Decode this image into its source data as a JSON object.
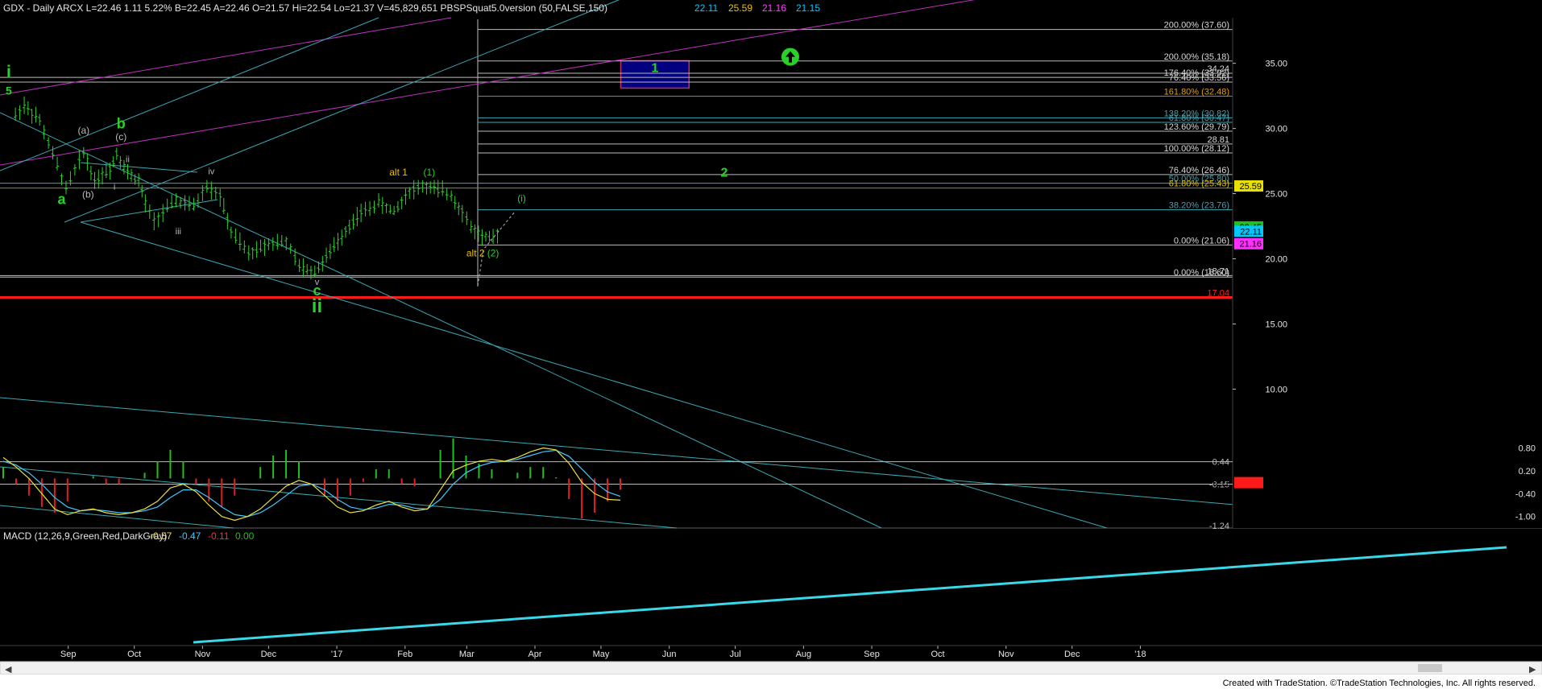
{
  "header": {
    "symbol_info": "GDX - Daily  ARCX  L=22.46  1.11  5.22%  B=22.45  A=22.46  O=21.57  Hi=22.54  Lo=21.37  V=45,829,651  PBSPSquat5.0version (50,FALSE,150)",
    "ind_values": [
      {
        "text": "22.11",
        "color": "#00c8ff"
      },
      {
        "text": "25.59",
        "color": "#e8c000"
      },
      {
        "text": "21.16",
        "color": "#ff40ff"
      },
      {
        "text": "21.15",
        "color": "#00c8ff"
      }
    ]
  },
  "macd": {
    "title": "MACD (12,26,9,Green,Red,DarkGray)",
    "values": [
      {
        "text": "-0.57",
        "color": "#e8e040"
      },
      {
        "text": "-0.47",
        "color": "#40c8ff"
      },
      {
        "text": "-0.11",
        "color": "#ff3030"
      },
      {
        "text": "0.00",
        "color": "#20c020"
      }
    ]
  },
  "colors": {
    "background": "#000000",
    "grid_lines": "#bcbcbc",
    "trend_lines": "#3aa8b4",
    "channel_magenta": "#c030c0",
    "bars": "#30d030",
    "wave_green": "#2ad02a",
    "target_box_fill": "#000080",
    "target_box_border": "#c03060",
    "support_red": "#ff1a1a",
    "macd_signal": "#40c8ff",
    "macd_line": "#e8e040"
  },
  "chart_data": [
    {
      "type": "bar",
      "title": "GDX - Daily",
      "subtitle": "ARCX",
      "series_style": "OHLC",
      "x_tick_labels": [
        "Sep",
        "Oct",
        "Nov",
        "Dec",
        "'17",
        "Feb",
        "Mar",
        "Apr",
        "May",
        "Jun",
        "Jul",
        "Aug",
        "Sep",
        "Oct",
        "Nov",
        "Dec",
        "'18"
      ],
      "y_tick_labels": [
        "35.00",
        "30.00",
        "25.00",
        "20.00",
        "15.00",
        "10.00"
      ],
      "ylim": [
        7,
        38.5
      ],
      "grid": false,
      "last_price": 22.46,
      "price_path": [
        {
          "date": "2016-08-08",
          "price": 31.0
        },
        {
          "date": "2016-08-12",
          "price": 31.8
        },
        {
          "date": "2016-08-19",
          "price": 30.6
        },
        {
          "date": "2016-08-25",
          "price": 28.0
        },
        {
          "date": "2016-08-31",
          "price": 25.4
        },
        {
          "date": "2016-09-08",
          "price": 28.2
        },
        {
          "date": "2016-09-13",
          "price": 26.0
        },
        {
          "date": "2016-09-20",
          "price": 26.9
        },
        {
          "date": "2016-09-23",
          "price": 28.1
        },
        {
          "date": "2016-09-28",
          "price": 26.6
        },
        {
          "date": "2016-10-03",
          "price": 26.0
        },
        {
          "date": "2016-10-06",
          "price": 24.2
        },
        {
          "date": "2016-10-10",
          "price": 22.9
        },
        {
          "date": "2016-10-20",
          "price": 24.5
        },
        {
          "date": "2016-10-28",
          "price": 24.0
        },
        {
          "date": "2016-11-03",
          "price": 25.6
        },
        {
          "date": "2016-11-09",
          "price": 24.8
        },
        {
          "date": "2016-11-14",
          "price": 22.0
        },
        {
          "date": "2016-11-22",
          "price": 20.4
        },
        {
          "date": "2016-12-01",
          "price": 21.2
        },
        {
          "date": "2016-12-09",
          "price": 21.3
        },
        {
          "date": "2016-12-15",
          "price": 19.4
        },
        {
          "date": "2016-12-22",
          "price": 19.0
        },
        {
          "date": "2016-12-29",
          "price": 20.5
        },
        {
          "date": "2017-01-05",
          "price": 22.2
        },
        {
          "date": "2017-01-12",
          "price": 23.5
        },
        {
          "date": "2017-01-20",
          "price": 24.3
        },
        {
          "date": "2017-01-27",
          "price": 23.6
        },
        {
          "date": "2017-02-03",
          "price": 25.2
        },
        {
          "date": "2017-02-09",
          "price": 25.6
        },
        {
          "date": "2017-02-16",
          "price": 25.3
        },
        {
          "date": "2017-02-22",
          "price": 24.9
        },
        {
          "date": "2017-02-27",
          "price": 23.6
        },
        {
          "date": "2017-03-03",
          "price": 22.4
        },
        {
          "date": "2017-03-08",
          "price": 21.7
        },
        {
          "date": "2017-03-13",
          "price": 21.5
        },
        {
          "date": "2017-03-17",
          "price": 22.46
        }
      ],
      "horizontal_levels": [
        {
          "label": "200.00% (37.60)",
          "value": 37.6
        },
        {
          "label": "200.00% (35.18)",
          "value": 35.18
        },
        {
          "label": "34.24",
          "value": 34.24
        },
        {
          "label": "176.40% (33.92)",
          "value": 33.92
        },
        {
          "label": "76.40% (33.56)",
          "value": 33.56
        },
        {
          "label": "161.80% (32.48)",
          "value": 32.48
        },
        {
          "label": "138.20% (30.82)",
          "value": 30.82
        },
        {
          "label": "61.80% (30.47)",
          "value": 30.47
        },
        {
          "label": "123.60% (29.79)",
          "value": 29.79
        },
        {
          "label": "28.81",
          "value": 28.81
        },
        {
          "label": "100.00% (28.12)",
          "value": 28.12
        },
        {
          "label": "76.40% (26.46)",
          "value": 26.46
        },
        {
          "label": "50.00% (25.80)",
          "value": 25.8
        },
        {
          "label": "61.80% (25.43)",
          "value": 25.43
        },
        {
          "label": "38.20% (23.76)",
          "value": 23.76
        },
        {
          "label": "0.00% (21.06)",
          "value": 21.06
        },
        {
          "label": "18.71",
          "value": 18.71
        },
        {
          "label": "0.00% (18.60)",
          "value": 18.6
        },
        {
          "label": "17.04",
          "value": 17.04
        }
      ],
      "price_tags": [
        {
          "text": "25.59",
          "value": 25.59,
          "bg": "#e8e000",
          "fg": "#000000"
        },
        {
          "text": "22.45",
          "value": 22.45,
          "bg": "#20c020",
          "fg": "#000000"
        },
        {
          "text": "22.11",
          "value": 22.11,
          "bg": "#00c8ff",
          "fg": "#000000"
        },
        {
          "text": "21.16",
          "value": 21.16,
          "bg": "#ff30ff",
          "fg": "#000000"
        }
      ],
      "target_box": {
        "label": "1",
        "date_start": "2017-05-10",
        "date_end": "2017-06-10",
        "price_low": 33.1,
        "price_high": 35.2
      },
      "annotations": [
        {
          "text": "i",
          "date": "2016-08-05",
          "price": 33.9,
          "color": "#2ad02a",
          "size": 22,
          "bold": true
        },
        {
          "text": "5",
          "date": "2016-08-05",
          "price": 32.6,
          "color": "#2ad02a",
          "size": 14,
          "bold": true
        },
        {
          "text": "b",
          "date": "2016-09-25",
          "price": 30.0,
          "color": "#2ad02a",
          "size": 18,
          "bold": true
        },
        {
          "text": "(a)",
          "date": "2016-09-08",
          "price": 29.6,
          "color": "#bbbbbb",
          "size": 12
        },
        {
          "text": "(c)",
          "date": "2016-09-25",
          "price": 29.1,
          "color": "#bbbbbb",
          "size": 12
        },
        {
          "text": "ii",
          "date": "2016-09-28",
          "price": 27.4,
          "color": "#bbbbbb",
          "size": 11
        },
        {
          "text": "i",
          "date": "2016-09-22",
          "price": 25.3,
          "color": "#bbbbbb",
          "size": 11
        },
        {
          "text": "(b)",
          "date": "2016-09-10",
          "price": 24.7,
          "color": "#bbbbbb",
          "size": 12
        },
        {
          "text": "a",
          "date": "2016-08-29",
          "price": 24.2,
          "color": "#2ad02a",
          "size": 18,
          "bold": true
        },
        {
          "text": "iv",
          "date": "2016-11-05",
          "price": 26.5,
          "color": "#bbbbbb",
          "size": 11
        },
        {
          "text": "iii",
          "date": "2016-10-21",
          "price": 21.9,
          "color": "#bbbbbb",
          "size": 11
        },
        {
          "text": "v",
          "date": "2016-12-23",
          "price": 18.0,
          "color": "#bbbbbb",
          "size": 11
        },
        {
          "text": "c",
          "date": "2016-12-23",
          "price": 17.2,
          "color": "#2ad02a",
          "size": 18,
          "bold": true
        },
        {
          "text": "ii",
          "date": "2016-12-23",
          "price": 15.9,
          "color": "#2ad02a",
          "size": 24,
          "bold": true
        },
        {
          "text": "alt 1",
          "date": "2017-01-29",
          "price": 26.4,
          "color": "#e8c000",
          "size": 12
        },
        {
          "text": "(1)",
          "date": "2017-02-12",
          "price": 26.4,
          "color": "#2ad02a",
          "size": 12
        },
        {
          "text": "(i)",
          "date": "2017-03-26",
          "price": 24.4,
          "color": "#2ad02a",
          "size": 12
        },
        {
          "text": "alt 2",
          "date": "2017-03-05",
          "price": 20.2,
          "color": "#e8c000",
          "size": 12
        },
        {
          "text": "(2)",
          "date": "2017-03-13",
          "price": 20.2,
          "color": "#2ad02a",
          "size": 12
        },
        {
          "text": "2",
          "date": "2017-06-26",
          "price": 26.3,
          "color": "#2ad02a",
          "size": 16,
          "bold": true
        }
      ]
    },
    {
      "type": "line",
      "title": "MACD (12,26,9,Green,Red,DarkGray)",
      "y_tick_labels": [
        "0.80",
        "0.20",
        "-0.40",
        "-1.00"
      ],
      "ylim": [
        -1.28,
        0.98
      ],
      "reference_levels": [
        {
          "label": "0.44",
          "value": 0.44
        },
        {
          "label": "-0.15",
          "value": -0.15
        },
        {
          "label": "-0.11",
          "value": -0.11
        },
        {
          "label": "-1.24",
          "value": -1.24
        }
      ],
      "series": [
        {
          "name": "MACD",
          "values": [
            0.55,
            0.3,
            0.0,
            -0.4,
            -0.8,
            -0.95,
            -0.85,
            -0.8,
            -0.9,
            -0.95,
            -0.9,
            -0.8,
            -0.6,
            -0.25,
            -0.15,
            -0.35,
            -0.7,
            -1.0,
            -1.1,
            -1.0,
            -0.8,
            -0.5,
            -0.2,
            -0.05,
            -0.15,
            -0.45,
            -0.75,
            -0.9,
            -0.85,
            -0.7,
            -0.6,
            -0.75,
            -0.85,
            -0.8,
            -0.3,
            0.2,
            0.35,
            0.45,
            0.5,
            0.45,
            0.55,
            0.7,
            0.8,
            0.75,
            0.4,
            -0.1,
            -0.4,
            -0.55,
            -0.57
          ]
        },
        {
          "name": "MACD Avg",
          "values": [
            0.45,
            0.35,
            0.15,
            -0.15,
            -0.5,
            -0.75,
            -0.85,
            -0.82,
            -0.85,
            -0.9,
            -0.9,
            -0.85,
            -0.75,
            -0.5,
            -0.3,
            -0.3,
            -0.5,
            -0.75,
            -0.95,
            -1.0,
            -0.9,
            -0.7,
            -0.45,
            -0.2,
            -0.15,
            -0.3,
            -0.55,
            -0.75,
            -0.82,
            -0.78,
            -0.68,
            -0.7,
            -0.78,
            -0.8,
            -0.55,
            -0.15,
            0.15,
            0.32,
            0.42,
            0.45,
            0.5,
            0.6,
            0.7,
            0.74,
            0.58,
            0.25,
            -0.1,
            -0.35,
            -0.47
          ]
        }
      ]
    }
  ],
  "footer": {
    "credit": "Created with TradeStation. ©TradeStation Technologies, Inc. All rights reserved."
  }
}
